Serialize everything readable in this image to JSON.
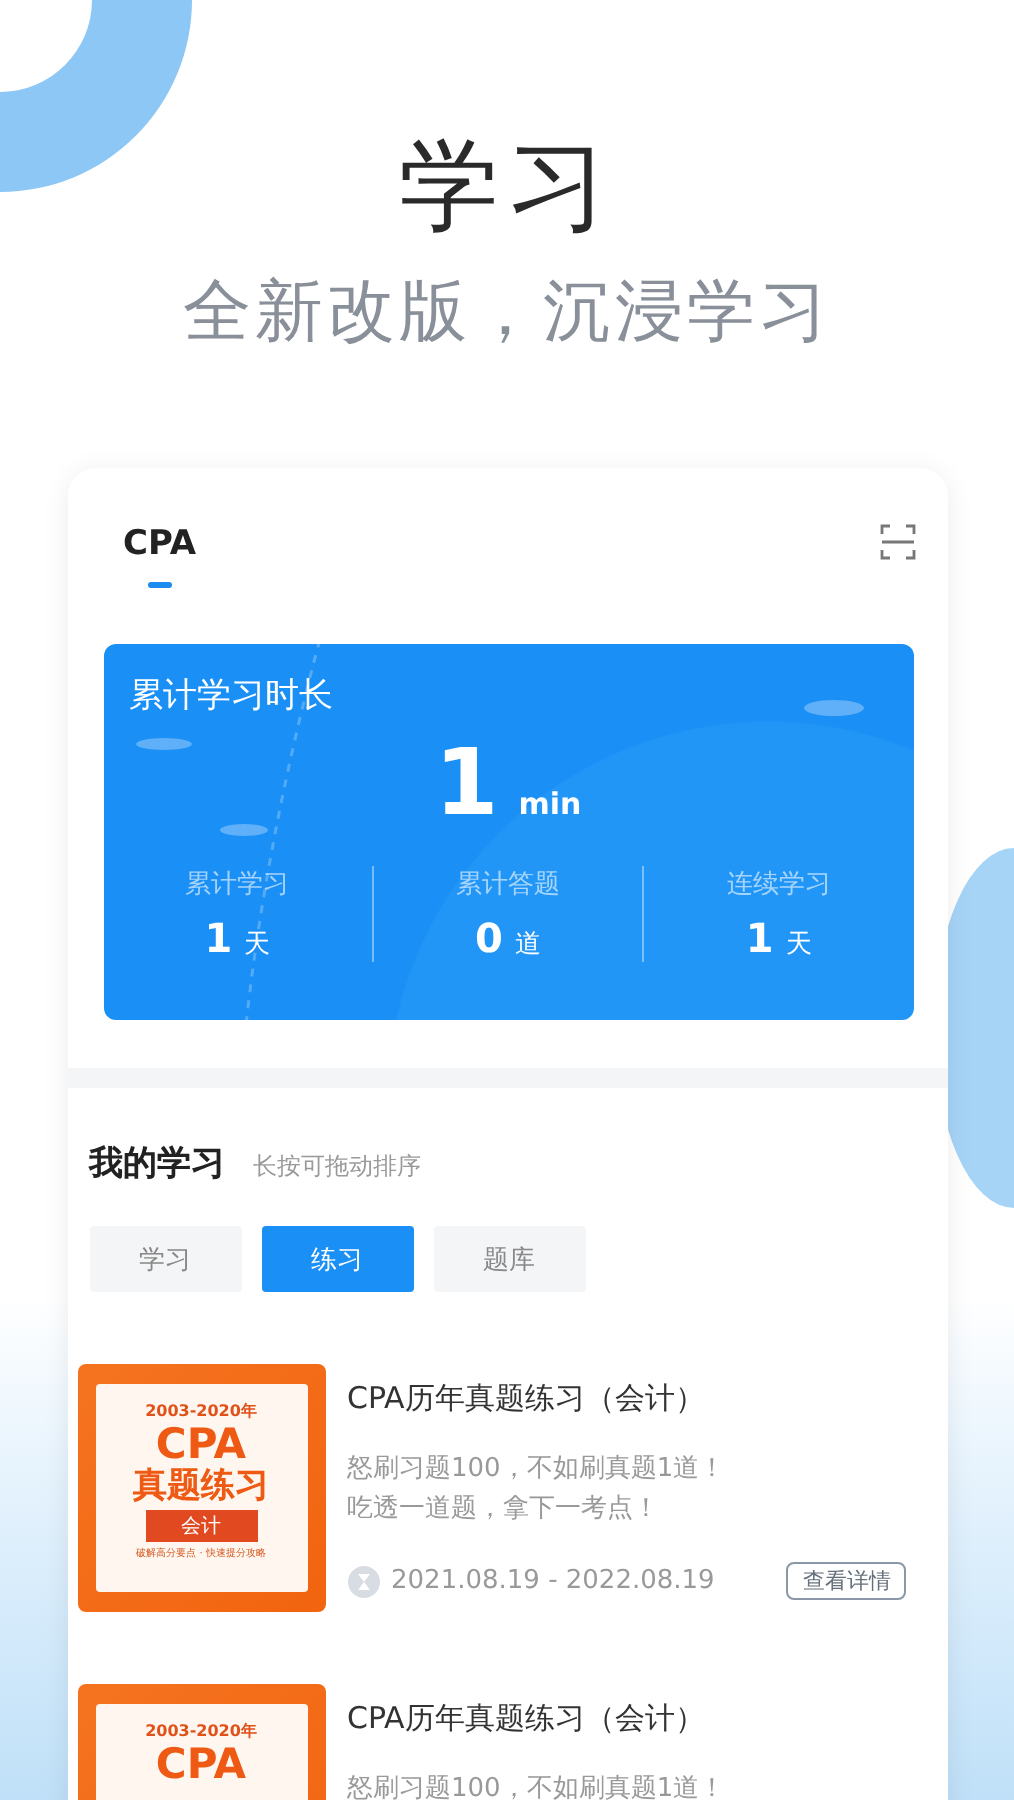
{
  "header": {
    "title": "学习",
    "subtitle": "全新改版，沉浸学习"
  },
  "subject_tabs": [
    {
      "label": "CPA",
      "selected": true
    }
  ],
  "study_panel": {
    "title": "累计学习时长",
    "value": "1",
    "unit": "min",
    "stats": [
      {
        "label": "累计学习",
        "value": "1",
        "unit": "天"
      },
      {
        "label": "累计答题",
        "value": "0",
        "unit": "道"
      },
      {
        "label": "连续学习",
        "value": "1",
        "unit": "天"
      }
    ]
  },
  "my_study": {
    "title": "我的学习",
    "hint": "长按可拖动排序",
    "tabs": [
      {
        "label": "学习",
        "selected": false
      },
      {
        "label": "练习",
        "selected": true
      },
      {
        "label": "题库",
        "selected": false
      }
    ],
    "courses": [
      {
        "cover": {
          "years": "2003-2020年",
          "brand": "CPA",
          "name": "真题练习",
          "subject": "会计",
          "tagline": "破解高分要点 · 快速提分攻略"
        },
        "title": "CPA历年真题练习（会计）",
        "description": [
          "怒刷习题100，不如刷真题1道！",
          "吃透一道题，拿下一考点！"
        ],
        "period": "2021.08.19 - 2022.08.19",
        "action": "查看详情"
      },
      {
        "cover": {
          "years": "2003-2020年",
          "brand": "CPA"
        },
        "title": "CPA历年真题练习（会计）",
        "description": [
          "怒刷习题100，不如刷真题1道！"
        ]
      }
    ]
  }
}
